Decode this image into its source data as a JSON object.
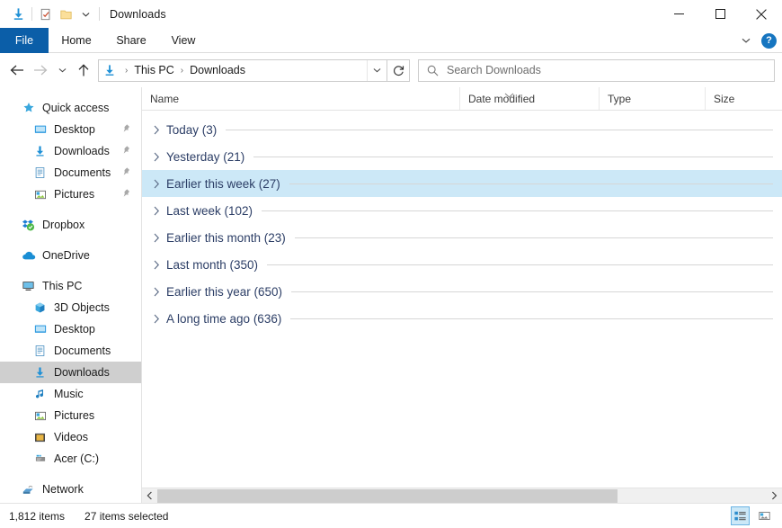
{
  "window": {
    "title": "Downloads",
    "quick_access_toolbar": [
      {
        "name": "downloads-folder-icon",
        "label": "Downloads"
      },
      {
        "name": "properties-icon",
        "label": "Properties"
      },
      {
        "name": "new-folder-icon",
        "label": "New folder"
      },
      {
        "name": "customize-qat-chevron-icon",
        "label": "Customize Quick Access Toolbar"
      }
    ],
    "controls": {
      "minimize": "Minimize",
      "maximize": "Maximize",
      "close": "Close"
    }
  },
  "ribbon": {
    "tabs": [
      {
        "label": "File",
        "active": true
      },
      {
        "label": "Home",
        "active": false
      },
      {
        "label": "Share",
        "active": false
      },
      {
        "label": "View",
        "active": false
      }
    ],
    "expand_label": "Expand the Ribbon",
    "help_label": "?"
  },
  "navigation": {
    "back_label": "Back",
    "forward_label": "Forward",
    "recent_label": "Recent locations",
    "up_label": "Up",
    "refresh_label": "Refresh",
    "breadcrumb": [
      {
        "label": "This PC"
      },
      {
        "label": "Downloads"
      }
    ],
    "breadcrumb_separator": "›",
    "address_dropdown_label": "Previous locations"
  },
  "search": {
    "placeholder": "Search Downloads",
    "icon": "search-icon"
  },
  "sidebar": {
    "groups": [
      {
        "header": {
          "label": "Quick access",
          "icon": "star-icon"
        },
        "items": [
          {
            "label": "Desktop",
            "icon": "desktop-icon",
            "pinned": true
          },
          {
            "label": "Downloads",
            "icon": "download-icon",
            "pinned": true
          },
          {
            "label": "Documents",
            "icon": "documents-icon",
            "pinned": true
          },
          {
            "label": "Pictures",
            "icon": "pictures-icon",
            "pinned": true
          }
        ]
      },
      {
        "header": {
          "label": "Dropbox",
          "icon": "dropbox-icon"
        },
        "items": []
      },
      {
        "header": {
          "label": "OneDrive",
          "icon": "onedrive-cloud-icon"
        },
        "items": []
      },
      {
        "header": {
          "label": "This PC",
          "icon": "this-pc-icon"
        },
        "items": [
          {
            "label": "3D Objects",
            "icon": "3d-objects-icon",
            "pinned": false
          },
          {
            "label": "Desktop",
            "icon": "desktop-icon",
            "pinned": false
          },
          {
            "label": "Documents",
            "icon": "documents-icon",
            "pinned": false
          },
          {
            "label": "Downloads",
            "icon": "download-icon",
            "pinned": false,
            "selected": true
          },
          {
            "label": "Music",
            "icon": "music-note-icon",
            "pinned": false
          },
          {
            "label": "Pictures",
            "icon": "pictures-icon",
            "pinned": false
          },
          {
            "label": "Videos",
            "icon": "videos-icon",
            "pinned": false
          },
          {
            "label": "Acer (C:)",
            "icon": "hard-drive-icon",
            "pinned": false
          }
        ]
      },
      {
        "header": {
          "label": "Network",
          "icon": "network-icon"
        },
        "items": []
      }
    ]
  },
  "file_list": {
    "columns": [
      {
        "label": "Name",
        "sorted": false
      },
      {
        "label": "Date modified",
        "sorted": true,
        "direction": "descending"
      },
      {
        "label": "Type",
        "sorted": false
      },
      {
        "label": "Size",
        "sorted": false
      }
    ],
    "groups": [
      {
        "label": "Today (3)",
        "expanded": false,
        "selected": false
      },
      {
        "label": "Yesterday (21)",
        "expanded": false,
        "selected": false
      },
      {
        "label": "Earlier this week (27)",
        "expanded": false,
        "selected": true
      },
      {
        "label": "Last week (102)",
        "expanded": false,
        "selected": false
      },
      {
        "label": "Earlier this month (23)",
        "expanded": false,
        "selected": false
      },
      {
        "label": "Last month (350)",
        "expanded": false,
        "selected": false
      },
      {
        "label": "Earlier this year (650)",
        "expanded": false,
        "selected": false
      },
      {
        "label": "A long time ago (636)",
        "expanded": false,
        "selected": false
      }
    ]
  },
  "scrollbar": {
    "left_arrow": "‹",
    "right_arrow": "›",
    "thumb_fraction": 0.755
  },
  "statusbar": {
    "item_count": "1,812 items",
    "selection": "27 items selected",
    "views": [
      {
        "name": "details-view-button",
        "label": "Details view",
        "active": true
      },
      {
        "name": "large-icons-view-button",
        "label": "Large icons view",
        "active": false
      }
    ]
  },
  "colors": {
    "accent_blue": "#0b5ea8",
    "selection_blue": "#cce8f7",
    "selection_gray": "#cfcfcf",
    "group_label": "#2c3e66",
    "download_arrow": "#1e90d6"
  }
}
